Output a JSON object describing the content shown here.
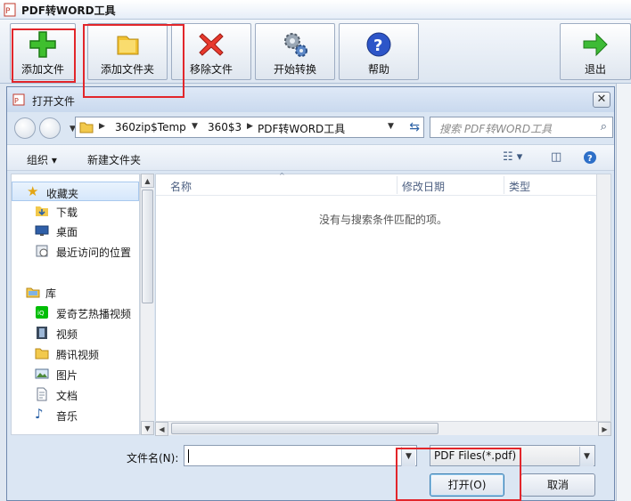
{
  "app": {
    "title": "PDF转WORD工具",
    "toolbar": [
      {
        "label": "添加文件",
        "icon": "plus-icon"
      },
      {
        "label": "添加文件夹",
        "icon": "folder-icon"
      },
      {
        "label": "移除文件",
        "icon": "delete-x-icon"
      },
      {
        "label": "开始转换",
        "icon": "gears-icon"
      },
      {
        "label": "帮助",
        "icon": "help-icon"
      },
      {
        "label": "退出",
        "icon": "exit-arrow-icon"
      }
    ]
  },
  "dialog": {
    "title": "打开文件",
    "close": "✕",
    "address": {
      "segments": [
        "360zip$Temp",
        "360$3",
        "PDF转WORD工具"
      ]
    },
    "search": {
      "placeholder": "搜索 PDF转WORD工具"
    },
    "commands": {
      "organize": "组织 ▾",
      "new_folder": "新建文件夹"
    },
    "nav": {
      "favorites": {
        "label": "收藏夹",
        "items": [
          "下载",
          "桌面",
          "最近访问的位置"
        ]
      },
      "libraries": {
        "label": "库",
        "items": [
          "爱奇艺热播视频",
          "视频",
          "腾讯视频",
          "图片",
          "文档",
          "音乐"
        ]
      }
    },
    "columns": {
      "name": "名称",
      "modified": "修改日期",
      "type": "类型"
    },
    "empty_message": "没有与搜索条件匹配的项。",
    "filename": {
      "label": "文件名(N):",
      "value": ""
    },
    "filter": {
      "value": "PDF Files(*.pdf)"
    },
    "buttons": {
      "open": "打开(O)",
      "cancel": "取消"
    }
  },
  "colors": {
    "highlight_box": "#e2262b",
    "title_bar": "#dfe9f7"
  }
}
